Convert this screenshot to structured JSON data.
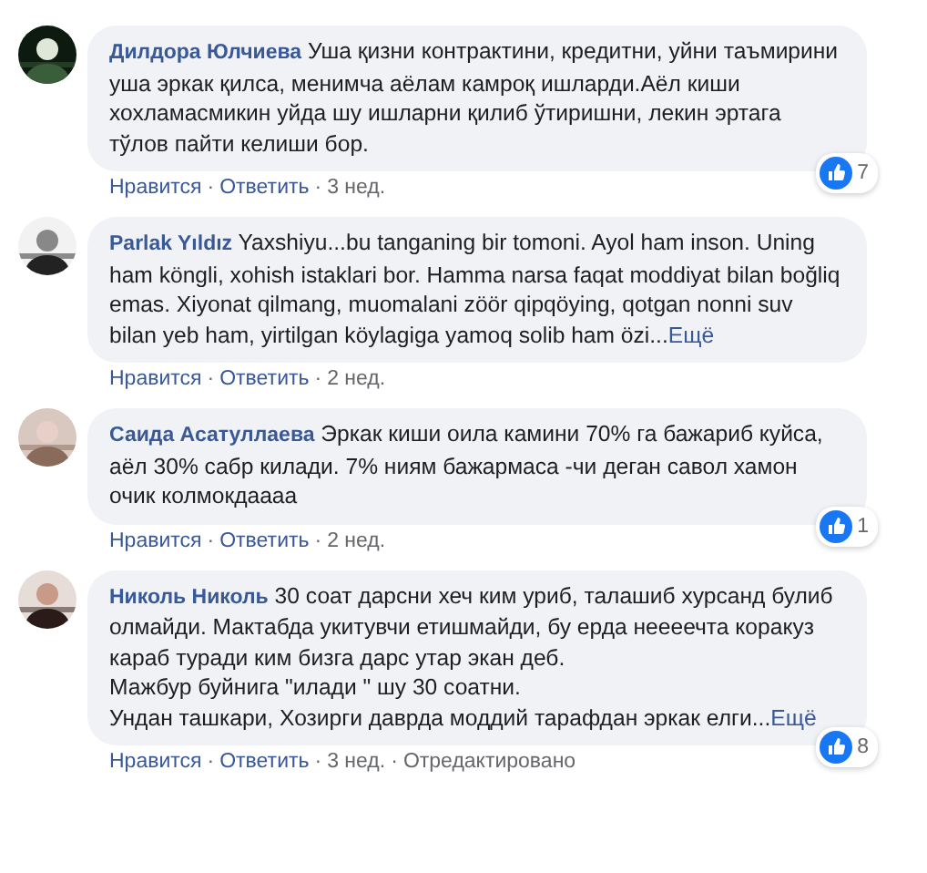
{
  "separator": "·",
  "comments": [
    {
      "author": "Дилдора Юлчиева",
      "text": "Уша қизни контрактини, кредитни, уйни таъмирини уша эркак қилса, менимча аёлам камроқ ишларди.Аёл киши хохламасмикин уйда шу ишларни қилиб ўтиришни, лекин эртага тўлов пайти келиши бор.",
      "reactions": "7",
      "actions": [
        "Нравится",
        "Ответить"
      ],
      "time": "3 нед."
    },
    {
      "author": "Parlak Yıldız",
      "text": "Yaxshiyu...bu tanganing bir tomoni. Ayol ham inson. Uning ham köngli, xohish istaklari bor. Hamma narsa faqat moddiyat bilan boğliq emas. Xiyonat qilmang, muomalani zöör qipqöying, qotgan nonni suv bilan yeb ham, yirtilgan köylagiga yamoq solib ham özi...",
      "more": "Ещё",
      "actions": [
        "Нравится",
        "Ответить"
      ],
      "time": "2 нед."
    },
    {
      "author": "Саида Асатуллаева",
      "text": "Эркак киши оила камини 70% га бажариб куйса, аёл 30% сабр килади. 7% ниям бажармаса -чи деган савол хамон очик колмокдаааа",
      "reactions": "1",
      "actions": [
        "Нравится",
        "Ответить"
      ],
      "time": "2 нед."
    },
    {
      "author": "Николь Николь",
      "text": "30 соат дарсни хеч ким уриб, талашиб хурсанд булиб олмайди. Мактабда укитувчи етишмайди, бу ерда неееечта коракуз караб туради ким бизга дарс утар экан деб.\nМажбур буйнига \"илади \" шу 30 соатни.\nУндан ташкари, Хозирги даврда моддий тарафдан эркак елги...",
      "more": "Ещё",
      "reactions": "8",
      "actions": [
        "Нравится",
        "Ответить"
      ],
      "time": "3 нед.",
      "edited": "Отредактировано"
    }
  ]
}
